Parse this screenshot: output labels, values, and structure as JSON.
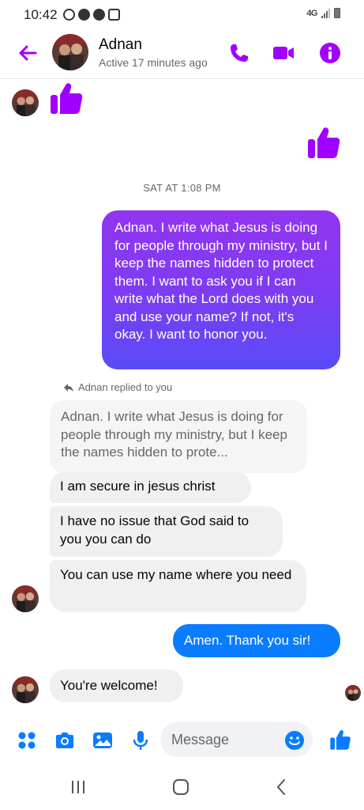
{
  "status_bar": {
    "time": "10:42",
    "network": "4G",
    "icons_left": [
      "sync-icon",
      "messenger-icon",
      "messenger-icon",
      "gallery-icon"
    ]
  },
  "header": {
    "contact_name": "Adnan",
    "contact_status": "Active 17 minutes ago",
    "accent_color": "#a100ff"
  },
  "messages": {
    "timestamp": "SAT AT 1:08 PM",
    "outgoing_long": "Adnan.  I write what Jesus is doing for people through my ministry, but I keep the names hidden to protect them.  I want to ask you if I can write what the Lord does with you and use your name?  If not, it's okay.  I want to honor you.",
    "reply_note": "Adnan replied to you",
    "reply_quote": "Adnan.  I write what Jesus is doing for people through my ministry, but I keep the names hidden to prote...",
    "in_1": "I  am secure in jesus christ",
    "in_2": "I have no issue that God said to you you can do",
    "in_3": "You can use my name where you need",
    "out_short": "Amen.  Thank you sir!",
    "in_4": "You're welcome!"
  },
  "composer": {
    "placeholder": "Message"
  },
  "colors": {
    "outgoing_gradient_top": "#9334f0",
    "outgoing_gradient_bottom": "#5a4bf7",
    "blue_bubble": "#0a7cff",
    "incoming_bubble": "#f0f0f0",
    "icon_blue": "#0a7cff"
  }
}
